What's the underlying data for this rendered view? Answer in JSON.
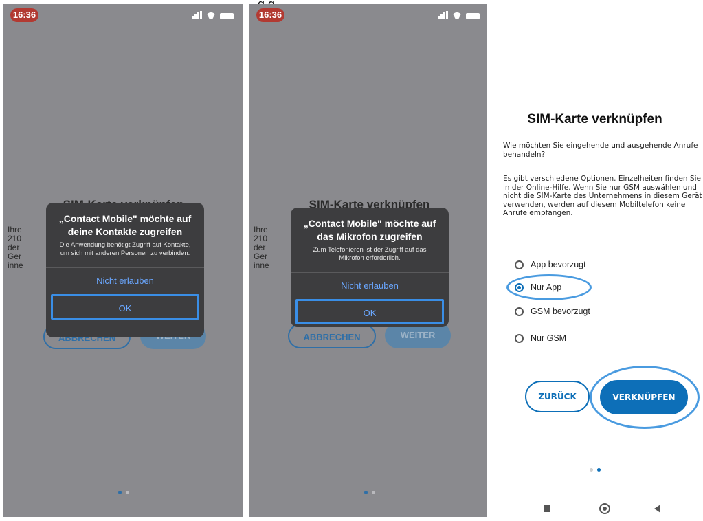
{
  "top_fragment": "g g",
  "status_bar": {
    "time": "16:36"
  },
  "ios_panels": [
    {
      "bg_title": "SIM-Karte verknüpfen",
      "bg_body_lines": [
        "Ihre",
        "210",
        "der",
        "Ger",
        "inne"
      ],
      "bg_buttons": {
        "cancel": "ABBRECHEN",
        "next": "WEITER"
      },
      "alert": {
        "title": "„Contact Mobile\" möchte auf deine Kontakte zugreifen",
        "message": "Die Anwendung benötigt Zugriff auf Kontakte, um sich mit anderen Personen zu verbinden.",
        "deny": "Nicht erlauben",
        "ok": "OK"
      }
    },
    {
      "bg_title": "SIM-Karte verknüpfen",
      "bg_body_lines": [
        "Ihre",
        "210",
        "der",
        "Ger",
        "inne"
      ],
      "bg_buttons": {
        "cancel": "ABBRECHEN",
        "next": "WEITER"
      },
      "alert": {
        "title": "„Contact Mobile\" möchte auf das Mikrofon zugreifen",
        "message": "Zum Telefonieren ist der Zugriff auf das Mikrofon erforderlich.",
        "deny": "Nicht erlauben",
        "ok": "OK"
      }
    }
  ],
  "android_panel": {
    "title": "SIM-Karte verknüpfen",
    "question": "Wie möchten Sie eingehende und ausgehende Anrufe behandeln?",
    "description": "Es gibt verschiedene Optionen. Einzelheiten finden Sie in der Online-Hilfe. Wenn Sie nur GSM auswählen und nicht die SIM-Karte des Unternehmens in diesem Gerät verwenden, werden auf diesem Mobiltelefon keine Anrufe empfangen.",
    "options": [
      {
        "label": "App bevorzugt",
        "selected": false
      },
      {
        "label": "Nur App",
        "selected": true
      },
      {
        "label": "GSM bevorzugt",
        "selected": false
      },
      {
        "label": "Nur GSM",
        "selected": false
      }
    ],
    "buttons": {
      "back": "ZURÜCK",
      "link": "VERKNÜPFEN"
    }
  },
  "colors": {
    "accent": "#0d6fb8",
    "highlight": "#3a8ee6",
    "ios_overlay": "#8a8a8e",
    "ios_alert": "#3d3d3f"
  },
  "icons": [
    "signal-icon",
    "wifi-icon",
    "battery-icon",
    "nav-recents-icon",
    "nav-home-icon",
    "nav-back-icon"
  ]
}
